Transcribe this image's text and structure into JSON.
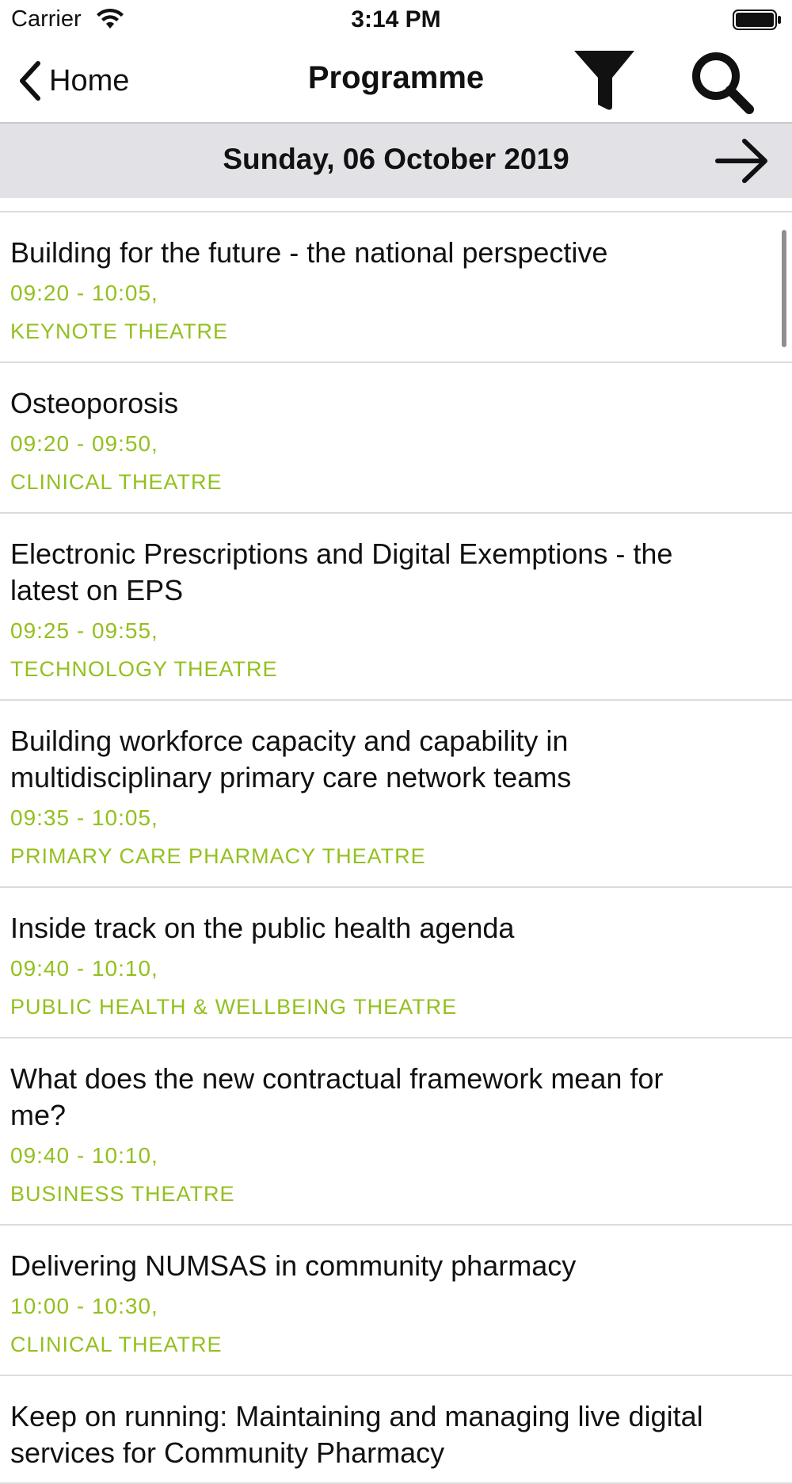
{
  "status_bar": {
    "carrier": "Carrier",
    "time": "3:14 PM",
    "wifi_icon": "wifi-icon",
    "battery_icon": "battery-icon"
  },
  "nav": {
    "back_label": "Home",
    "title": "Programme",
    "filter_icon": "filter-icon",
    "search_icon": "search-icon"
  },
  "date_bar": {
    "date": "Sunday, 06 October 2019",
    "next_icon": "arrow-right-icon"
  },
  "colors": {
    "accent": "#93c01f",
    "date_bar_bg": "#e1e1e6",
    "text": "#111111"
  },
  "sessions": [
    {
      "title": "Building for the future - the national perspective",
      "time": "09:20 - 10:05,",
      "venue": "KEYNOTE THEATRE"
    },
    {
      "title": "Osteoporosis",
      "time": "09:20 - 09:50,",
      "venue": "CLINICAL THEATRE"
    },
    {
      "title": "Electronic Prescriptions and Digital Exemptions - the latest on EPS",
      "time": "09:25 - 09:55,",
      "venue": "TECHNOLOGY THEATRE"
    },
    {
      "title": "Building workforce capacity and capability in multidisciplinary primary care network teams",
      "time": "09:35 - 10:05,",
      "venue": "PRIMARY CARE PHARMACY THEATRE"
    },
    {
      "title": "Inside track on the public health agenda",
      "time": "09:40 - 10:10,",
      "venue": "PUBLIC HEALTH & WELLBEING THEATRE"
    },
    {
      "title": "What does the new contractual framework mean for me?",
      "time": "09:40 - 10:10,",
      "venue": "BUSINESS THEATRE"
    },
    {
      "title": "Delivering NUMSAS in community pharmacy",
      "time": "10:00 - 10:30,",
      "venue": "CLINICAL THEATRE"
    },
    {
      "title": "Keep on running: Maintaining and managing live digital services for Community Pharmacy",
      "time": "",
      "venue": ""
    }
  ]
}
